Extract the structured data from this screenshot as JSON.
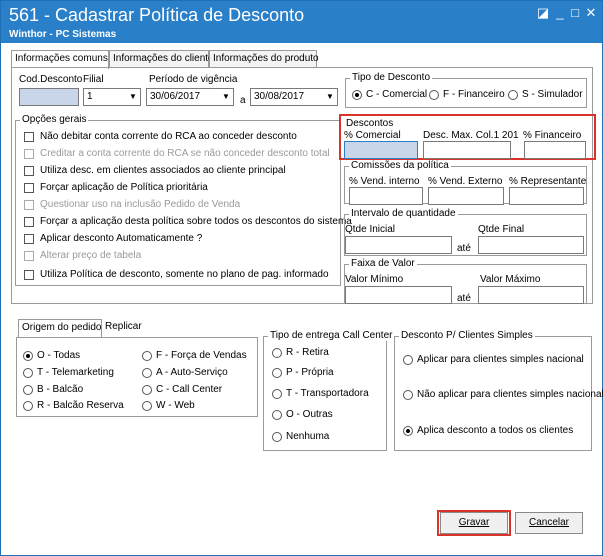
{
  "window": {
    "title": "561 - Cadastrar Política de Desconto",
    "subtitle": "Winthor - PC Sistemas",
    "controls": {
      "min": "_",
      "restore": "□",
      "close": "✕",
      "extra": "◪"
    }
  },
  "tabs": [
    "Informações comuns",
    "Informações do cliente",
    "Informações do produto"
  ],
  "header": {
    "cod_desconto_label": "Cod.Desconto",
    "cod_desconto_value": "",
    "filial_label": "Filial",
    "filial_value": "1",
    "periodo_label": "Período de vigência",
    "data_inicio": "30/06/2017",
    "separator": "a",
    "data_fim": "30/08/2017"
  },
  "opcoes_gerais": {
    "title": "Opções gerais",
    "items": [
      {
        "label": "Não debitar conta corrente do RCA ao conceder desconto",
        "disabled": false
      },
      {
        "label": "Creditar a conta corrente do RCA se não conceder desconto total",
        "disabled": true
      },
      {
        "label": "Utiliza desc. em clientes associados ao cliente principal",
        "disabled": false
      },
      {
        "label": "Forçar aplicação de Política prioritária",
        "disabled": false
      },
      {
        "label": "Questionar uso na inclusão Pedido de Venda",
        "disabled": true
      },
      {
        "label": "Forçar a aplicação desta política sobre todos os descontos do sistema",
        "disabled": false
      },
      {
        "label": "Aplicar desconto Automaticamente ?",
        "disabled": false
      },
      {
        "label": "Alterar preço de tabela",
        "disabled": true
      },
      {
        "label": "Utiliza Política de desconto, somente no plano de pag. informado",
        "disabled": false
      }
    ]
  },
  "tipo_desconto": {
    "title": "Tipo de Desconto",
    "options": [
      "C - Comercial",
      "F - Financeiro",
      "S - Simulador"
    ],
    "selected": 0
  },
  "descontos": {
    "title": "Descontos",
    "fields": [
      "% Comercial",
      "Desc. Max. Col.1 201",
      "% Financeiro"
    ]
  },
  "comissoes": {
    "title": "Comissões da política",
    "fields": [
      "% Vend. interno",
      "% Vend. Externo",
      "% Representante"
    ]
  },
  "intervalo": {
    "title": "Intervalo de quantidade",
    "inicial": "Qtde Inicial",
    "final": "Qtde Final",
    "ate": "até"
  },
  "faixa": {
    "title": "Faixa de Valor",
    "minimo": "Valor Mínimo",
    "maximo": "Valor Máximo",
    "ate": "até"
  },
  "bottom_tabs": [
    "Origem do pedido",
    "Replicar"
  ],
  "origem": {
    "left": [
      "O - Todas",
      "T - Telemarketing",
      "B - Balcão",
      "R - Balcão Reserva"
    ],
    "right": [
      "F - Força de Vendas",
      "A - Auto-Serviço",
      "C - Call Center",
      "W - Web"
    ],
    "selected": "O - Todas"
  },
  "entrega": {
    "title": "Tipo de entrega Call Center",
    "options": [
      "R - Retira",
      "P - Própria",
      "T - Transportadora",
      "O - Outras",
      "Nenhuma"
    ]
  },
  "simples": {
    "title": "Desconto P/ Clientes Simples",
    "options": [
      "Aplicar para clientes simples nacional",
      "Não aplicar para clientes simples nacional",
      "Aplica desconto a todos os clientes"
    ],
    "selected": 2
  },
  "buttons": {
    "gravar": "Gravar",
    "cancelar": "Cancelar"
  },
  "colors": {
    "title_bar": "#2a7fc9",
    "highlight": "#d9342b"
  }
}
